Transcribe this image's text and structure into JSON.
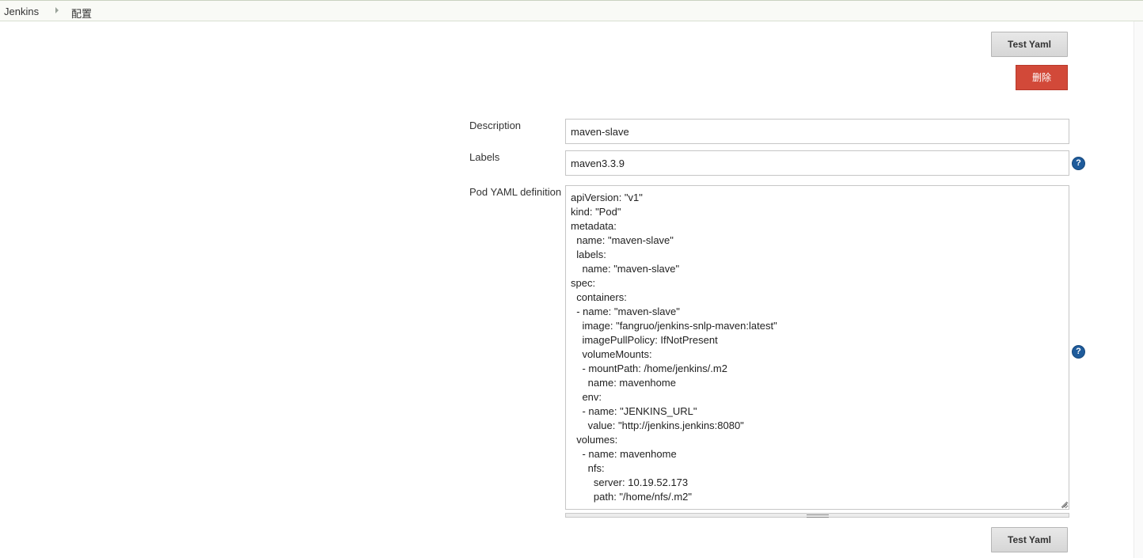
{
  "breadcrumb": {
    "items": [
      {
        "label": "Jenkins"
      },
      {
        "label": "配置"
      }
    ]
  },
  "toolbar": {
    "test_yaml_label": "Test Yaml",
    "delete_label": "删除"
  },
  "form": {
    "description": {
      "label": "Description",
      "value": "maven-slave"
    },
    "labels": {
      "label": "Labels",
      "value": "maven3.3.9"
    },
    "pod_yaml": {
      "label": "Pod YAML definition",
      "value": "apiVersion: \"v1\"\nkind: \"Pod\"\nmetadata:\n  name: \"maven-slave\"\n  labels:\n    name: \"maven-slave\"\nspec:\n  containers:\n  - name: \"maven-slave\"\n    image: \"fangruo/jenkins-snlp-maven:latest\"\n    imagePullPolicy: IfNotPresent\n    volumeMounts:\n    - mountPath: /home/jenkins/.m2\n      name: mavenhome\n    env:\n    - name: \"JENKINS_URL\"\n      value: \"http://jenkins.jenkins:8080\"\n  volumes:\n    - name: mavenhome\n      nfs:\n        server: 10.19.52.173\n        path: \"/home/nfs/.m2\""
    }
  },
  "footer": {
    "test_yaml_label": "Test Yaml"
  },
  "icons": {
    "help": "help-icon",
    "breadcrumb_separator": "chevron-right-icon"
  },
  "colors": {
    "delete_button": "#d24939",
    "help_icon": "#1e5b9b",
    "breadcrumb_bg": "#f9faf6"
  }
}
